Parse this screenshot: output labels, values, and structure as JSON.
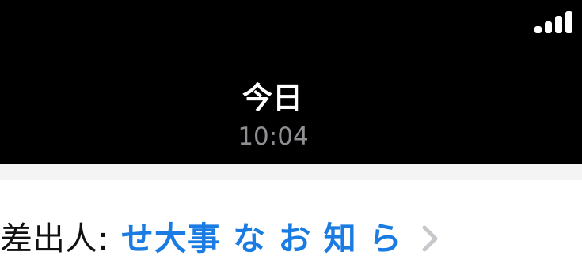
{
  "status_bar": {
    "signal_icon": "cellular-signal-icon"
  },
  "header": {
    "date_title": "今日",
    "time": "10:04"
  },
  "message": {
    "sender_label": "差出人:",
    "sender_name": "せ大事 な お 知 ら",
    "chevron_icon": "chevron-right-icon"
  },
  "colors": {
    "header_bg": "#000000",
    "sender_link": "#1a7ce2",
    "time_gray": "#8e8e93",
    "chevron_gray": "#c7c7cc"
  }
}
